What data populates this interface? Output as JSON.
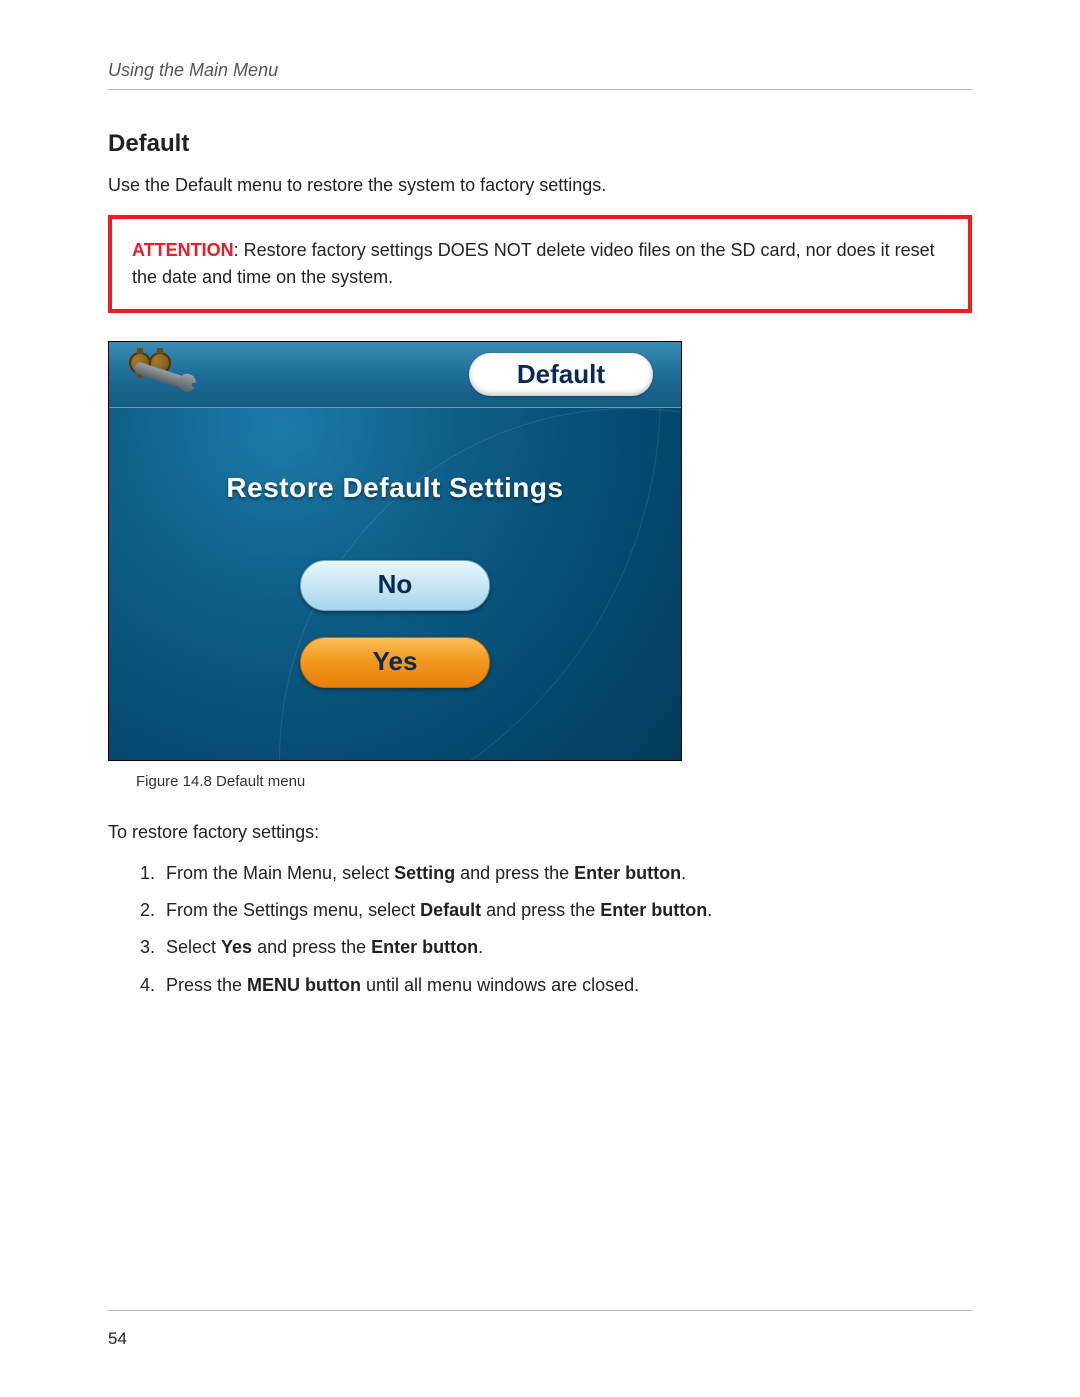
{
  "header": {
    "running_head": "Using the Main Menu"
  },
  "section": {
    "title": "Default",
    "intro": "Use the Default menu to restore the system to factory settings."
  },
  "attention": {
    "label": "ATTENTION",
    "text": ": Restore factory settings DOES NOT delete video files on the SD card, nor does it reset the date and time on the system."
  },
  "screenshot": {
    "title": "Default",
    "prompt": "Restore Default Settings",
    "no_label": "No",
    "yes_label": "Yes",
    "icon_name": "settings-gears-wrench"
  },
  "figure_caption": "Figure 14.8 Default menu",
  "steps_lead": "To restore factory settings:",
  "steps": [
    {
      "pre": "From the Main Menu, select ",
      "b1": "Setting",
      "mid": " and press the ",
      "b2": "Enter button",
      "post": "."
    },
    {
      "pre": "From the Settings menu, select ",
      "b1": "Default",
      "mid": " and press the ",
      "b2": "Enter button",
      "post": "."
    },
    {
      "pre": "Select ",
      "b1": "Yes",
      "mid": " and press the ",
      "b2": "Enter button",
      "post": "."
    },
    {
      "pre": "Press the ",
      "b1": "MENU button",
      "mid": " until all menu windows are closed.",
      "b2": "",
      "post": ""
    }
  ],
  "page_number": "54"
}
